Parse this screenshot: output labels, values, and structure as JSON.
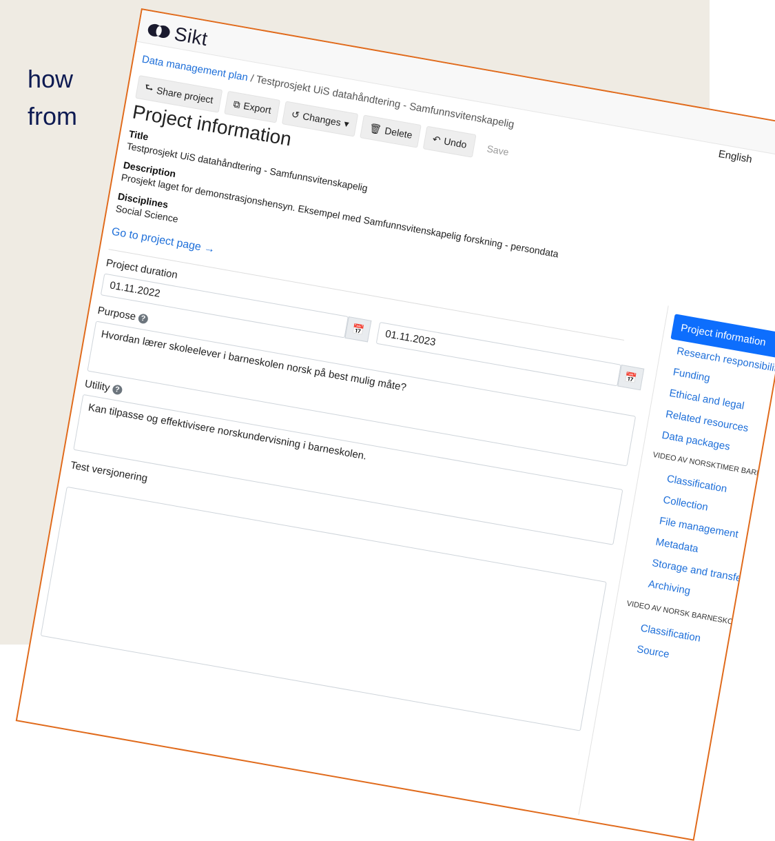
{
  "slide": {
    "line1": "how",
    "line2": "from"
  },
  "app": {
    "logo_text": "Sikt",
    "language": "English"
  },
  "breadcrumb": {
    "root": "Data management plan",
    "separator": "/",
    "current": "Testprosjekt UiS datahåndtering - Samfunnsvitenskapelig"
  },
  "toolbar": {
    "share": "Share project",
    "export": "Export",
    "changes": "Changes",
    "delete": "Delete",
    "undo": "Undo",
    "save": "Save"
  },
  "project": {
    "heading": "Project information",
    "title_label": "Title",
    "title_value": "Testprosjekt UiS datahåndtering - Samfunnsvitenskapelig",
    "description_label": "Description",
    "description_value": "Prosjekt laget for demonstrasjonshensyn. Eksempel med Samfunnsvitenskapelig forskning - persondata",
    "disciplines_label": "Disciplines",
    "disciplines_value": "Social Science",
    "project_link": "Go to project page →"
  },
  "form": {
    "duration_label": "Project duration",
    "start_date": "01.11.2022",
    "end_date": "01.11.2023",
    "purpose_label": "Purpose",
    "purpose_value": "Hvordan lærer skoleelever i barneskolen norsk på best mulig måte?",
    "utility_label": "Utility",
    "utility_value": "Kan tilpasse og effektivisere norskundervisning i barneskolen.",
    "note_value": "Test versjonering"
  },
  "sidebar": {
    "active": "Project information",
    "items": [
      "Research responsibility",
      "Funding",
      "Ethical and legal",
      "Related resources",
      "Data packages"
    ],
    "group1": "VIDEO AV NORSKTIMER BARNESKOLE",
    "group1_items": [
      "Classification",
      "Collection",
      "File management",
      "Metadata",
      "Storage and transfer",
      "Archiving"
    ],
    "group2": "VIDEO AV NORSK BARNESKOL...",
    "group2_items": [
      "Classification",
      "Source"
    ]
  },
  "colors": {
    "accent": "#0d6efd",
    "link": "#1e6fd9",
    "frame": "#e06a1b",
    "slide_bg": "#efebe3",
    "slide_text": "#0d1a52"
  }
}
